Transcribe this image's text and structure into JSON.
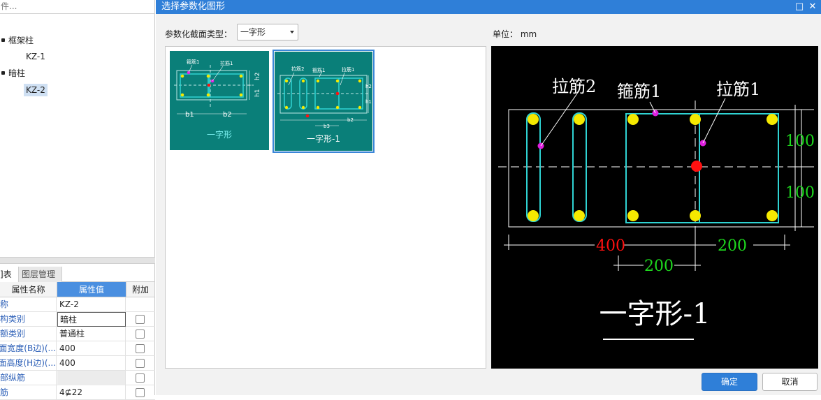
{
  "left_panel": {
    "search_placeholder": "件...",
    "tree": [
      {
        "label": "框架柱",
        "children": [
          "KZ-1"
        ]
      },
      {
        "label": "暗柱",
        "children": [
          "KZ-2"
        ]
      }
    ],
    "selected_leaf": "KZ-2",
    "tabs": [
      "属性列表",
      "图层管理"
    ],
    "tab_visible": [
      "]表",
      "图层管理"
    ],
    "props_header": {
      "name": "属性名称",
      "value": "属性值",
      "extra": "附加"
    },
    "props": [
      {
        "name": "名称",
        "name_shown": "称",
        "value": "KZ-2",
        "check": false
      },
      {
        "name": "结构类别",
        "name_shown": "构类别",
        "value": "暗柱",
        "check": true,
        "editing": true
      },
      {
        "name": "定额类别",
        "name_shown": "额类别",
        "value": "普通柱",
        "check": true
      },
      {
        "name": "截面宽度(B边)(...",
        "name_shown": "面宽度(B边)(...",
        "value": "400",
        "check": true
      },
      {
        "name": "截面高度(H边)(...",
        "name_shown": "面高度(H边)(...",
        "value": "400",
        "check": true
      },
      {
        "name": "全部纵筋",
        "name_shown": "部纵筋",
        "value": "",
        "check": true,
        "grey": true
      },
      {
        "name": "角筋",
        "name_shown": "筋",
        "value": "4⊈22",
        "check": true
      }
    ]
  },
  "dialog": {
    "title": "选择参数化图形",
    "section_type_label": "参数化截面类型：",
    "section_type_value": "一字形",
    "unit_label": "单位：  mm",
    "thumbnails": [
      {
        "caption": "一字形",
        "labels": {
          "hoop": "箍筋1",
          "tie": "拉筋1",
          "b1": "b1",
          "b2": "b2",
          "h1": "h1",
          "h2": "h2"
        }
      },
      {
        "caption": "一字形-1",
        "labels": {
          "tie2": "拉筋2",
          "hoop": "箍筋1",
          "tie1": "拉筋1",
          "b3": "b3",
          "b2": "b2",
          "h1": "h1",
          "h2": "h2"
        }
      }
    ],
    "selected_thumbnail": 1,
    "preview": {
      "label_tie2": "拉筋2",
      "label_hoop1": "箍筋1",
      "label_tie1": "拉筋1",
      "dim_h_top": "100",
      "dim_h_bottom": "100",
      "dim_total_left": "400",
      "dim_right": "200",
      "dim_inner": "200",
      "caption": "一字形-1"
    },
    "ok_label": "确定",
    "cancel_label": "取消",
    "colors": {
      "accent": "#2f7fd8",
      "teal": "#0a7f79",
      "cyan": "#2fd3d3",
      "rebar": "#f5e900",
      "magenta": "#e020e0",
      "red": "#ff1010",
      "green": "#1ed81e"
    }
  }
}
